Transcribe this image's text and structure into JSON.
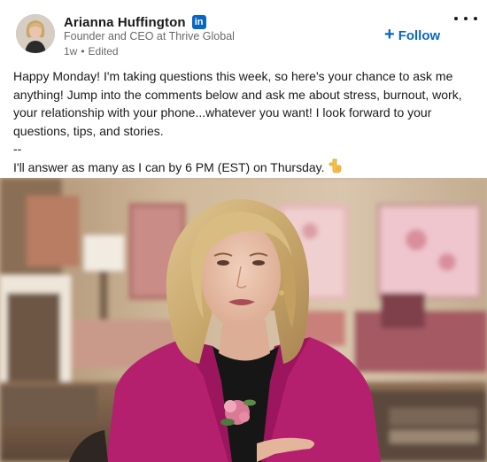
{
  "author": {
    "name": "Arianna Huffington",
    "network_badge": "in",
    "headline": "Founder and CEO at Thrive Global",
    "time": "1w",
    "separator": "•",
    "edited": "Edited"
  },
  "actions": {
    "follow_label": "Follow",
    "follow_icon": "plus-icon",
    "more_icon": "ellipsis-icon"
  },
  "post": {
    "paragraph_1": "Happy Monday! I'm taking questions this week, so here's your chance to ask me anything! Jump into the comments below and ask me about stress, burnout, work, your relationship with your phone...whatever you want! I look forward to your questions, tips, and stories.",
    "divider": "--",
    "paragraph_2": "I'll answer as many as I can by 6 PM (EST) on Thursday.",
    "emoji_icon": "pointing-down-hand-icon"
  },
  "media": {
    "type": "video-still"
  },
  "colors": {
    "accent": "#0a66c2",
    "jacket": "#b5206e",
    "text_primary": "#1b1b1b",
    "text_secondary": "#666666"
  }
}
